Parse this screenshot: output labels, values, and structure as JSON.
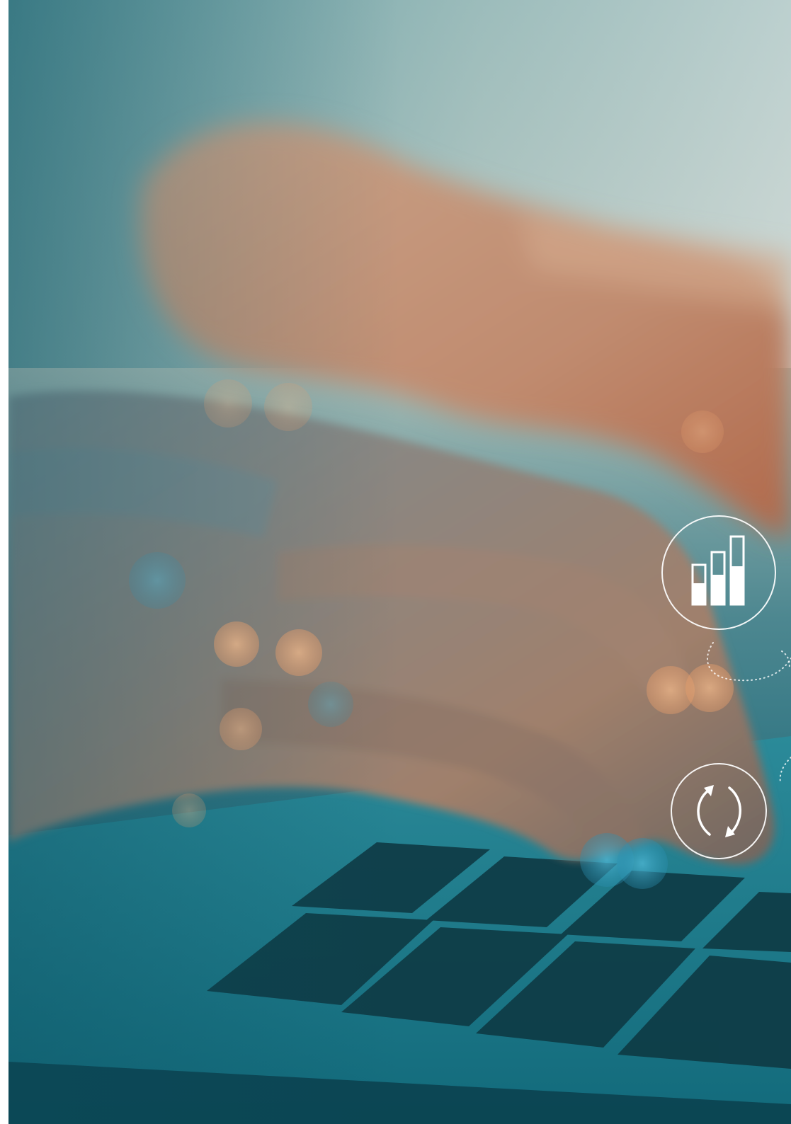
{
  "image": {
    "subject": "hands-typing-on-laptop",
    "tint_colors": {
      "teal": "#1d6f80",
      "deep_teal": "#0e4a5a",
      "skin": "#c99a80",
      "bokeh": "#e7a77a",
      "sky": "#c7d3d1"
    }
  },
  "overlay_icons": [
    {
      "name": "bar-chart-icon",
      "color": "#ffffff"
    },
    {
      "name": "refresh-cycle-icon",
      "color": "#ffffff"
    }
  ]
}
